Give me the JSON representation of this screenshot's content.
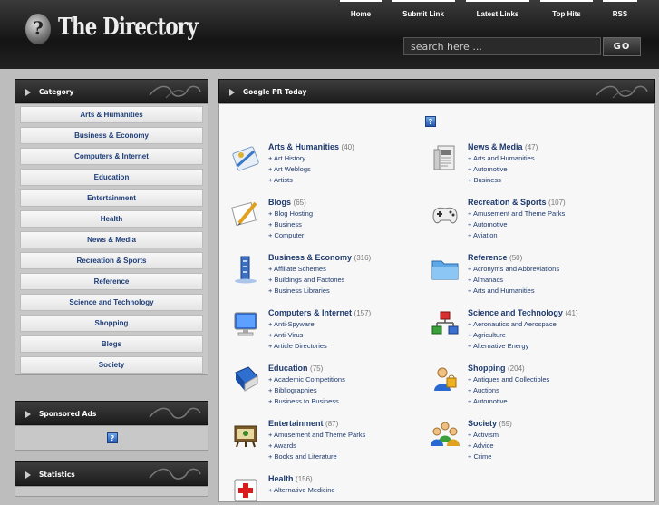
{
  "header": {
    "title": "The Directory",
    "logo_glyph": "?",
    "nav": [
      "Home",
      "Submit Link",
      "Latest Links",
      "Top Hits",
      "RSS"
    ],
    "search": {
      "placeholder": "search here ...",
      "button": "GO"
    }
  },
  "sidebar": {
    "category_title": "Category",
    "categories": [
      "Arts & Humanities",
      "Business & Economy",
      "Computers & Internet",
      "Education",
      "Entertainment",
      "Health",
      "News & Media",
      "Recreation & Sports",
      "Reference",
      "Science and Technology",
      "Shopping",
      "Blogs",
      "Society"
    ],
    "sponsored_title": "Sponsored Ads",
    "statistics_title": "Statistics"
  },
  "main": {
    "title": "Google PR Today",
    "left": [
      {
        "name": "Arts & Humanities",
        "count": "(40)",
        "icon": "paint-icon",
        "subs": [
          "+ Art History",
          "+ Art Weblogs",
          "+ Artists"
        ]
      },
      {
        "name": "Blogs",
        "count": "(65)",
        "icon": "pencil-paper-icon",
        "subs": [
          "+ Blog Hosting",
          "+ Business",
          "+ Computer"
        ]
      },
      {
        "name": "Business & Economy",
        "count": "(316)",
        "icon": "building-icon",
        "subs": [
          "+ Affiliate Schemes",
          "+ Buildings and Factories",
          "+ Business Libraries"
        ]
      },
      {
        "name": "Computers & Internet",
        "count": "(157)",
        "icon": "monitor-icon",
        "subs": [
          "+ Anti-Spyware",
          "+ Anti-Virus",
          "+ Article Directories"
        ]
      },
      {
        "name": "Education",
        "count": "(75)",
        "icon": "book-icon",
        "subs": [
          "+ Academic Competitions",
          "+ Bibliographies",
          "+ Business to Business"
        ]
      },
      {
        "name": "Entertainment",
        "count": "(87)",
        "icon": "film-icon",
        "subs": [
          "+ Amusement and Theme Parks",
          "+ Awards",
          "+ Books and Literature"
        ]
      },
      {
        "name": "Health",
        "count": "(156)",
        "icon": "first-aid-icon",
        "subs": [
          "+ Alternative Medicine"
        ]
      }
    ],
    "right": [
      {
        "name": "News & Media",
        "count": "(47)",
        "icon": "newspaper-icon",
        "subs": [
          "+ Arts and Humanities",
          "+ Automotive",
          "+ Business"
        ]
      },
      {
        "name": "Recreation & Sports",
        "count": "(107)",
        "icon": "gamepad-icon",
        "subs": [
          "+ Amusement and Theme Parks",
          "+ Automotive",
          "+ Aviation"
        ]
      },
      {
        "name": "Reference",
        "count": "(50)",
        "icon": "folder-icon",
        "subs": [
          "+ Acronyms and Abbreviations",
          "+ Almanacs",
          "+ Arts and Humanities"
        ]
      },
      {
        "name": "Science and Technology",
        "count": "(41)",
        "icon": "network-icon",
        "subs": [
          "+ Aeronautics and Aerospace",
          "+ Agriculture",
          "+ Alternative Energy"
        ]
      },
      {
        "name": "Shopping",
        "count": "(204)",
        "icon": "shopper-icon",
        "subs": [
          "+ Antiques and Collectibles",
          "+ Auctions",
          "+ Automotive"
        ]
      },
      {
        "name": "Society",
        "count": "(59)",
        "icon": "people-icon",
        "subs": [
          "+ Activism",
          "+ Advice",
          "+ Crime"
        ]
      }
    ]
  },
  "colors": {
    "link": "#1e3a6e",
    "header_bg": "#1c1c1c",
    "page_bg": "#bdbdbd"
  }
}
